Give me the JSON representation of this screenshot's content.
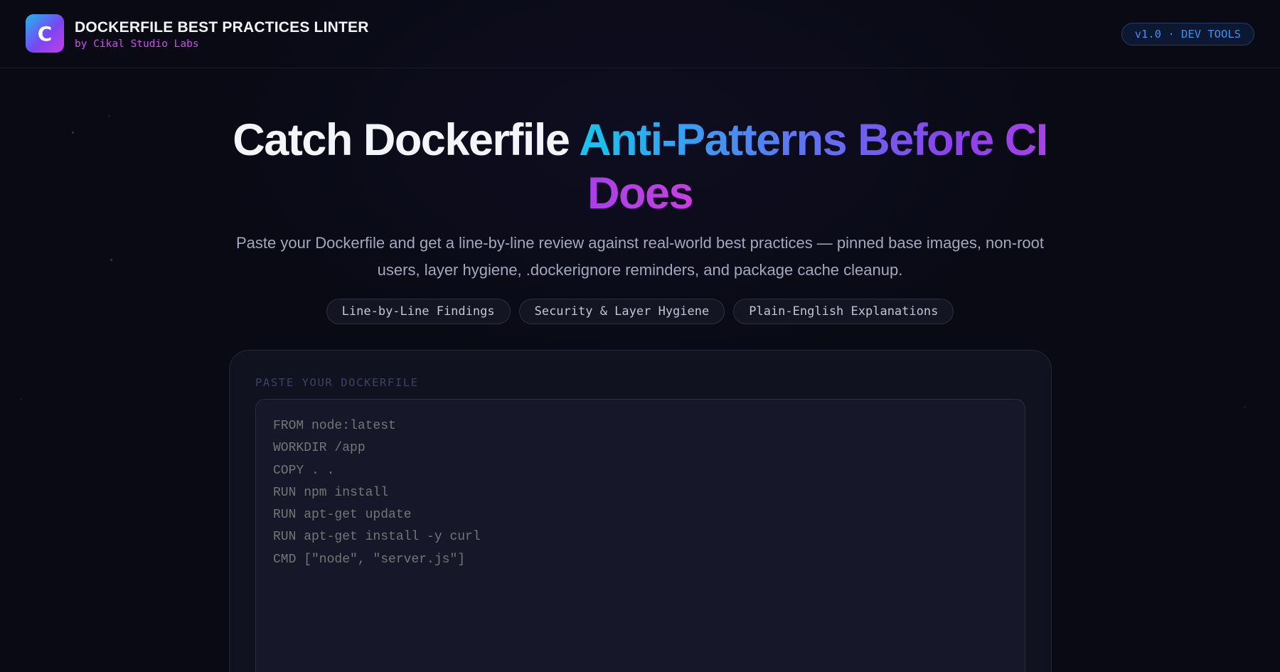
{
  "header": {
    "logo_letter": "C",
    "title": "DOCKERFILE BEST PRACTICES LINTER",
    "subtitle": "by Cikal Studio Labs",
    "version_badge": "v1.0 · DEV TOOLS"
  },
  "hero": {
    "title_plain": "Catch Dockerfile ",
    "title_highlight": "Anti-Patterns Before CI Does",
    "description": "Paste your Dockerfile and get a line-by-line review against real-world best practices — pinned base images, non-root users, layer hygiene, .dockerignore reminders, and package cache cleanup.",
    "features": [
      "Line-by-Line Findings",
      "Security & Layer Hygiene",
      "Plain-English Explanations"
    ]
  },
  "editor": {
    "label": "PASTE YOUR DOCKERFILE",
    "placeholder": "FROM node:latest\nWORKDIR /app\nCOPY . .\nRUN npm install\nRUN apt-get update\nRUN apt-get install -y curl\nCMD [\"node\", \"server.js\"]"
  },
  "colors": {
    "background": "#090a14",
    "brand_subtitle": "#c94fe8",
    "badge_text": "#3f8ff5",
    "gradient_start": "#12c8ef",
    "gradient_end": "#c93ee2"
  }
}
